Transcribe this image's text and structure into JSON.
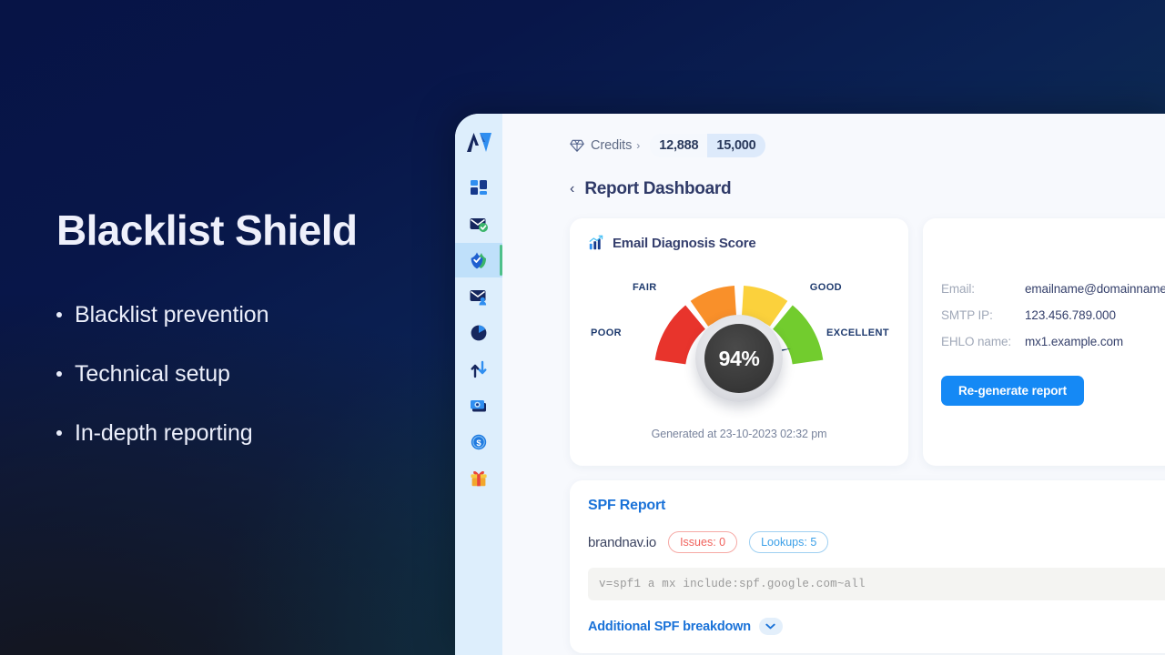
{
  "promo": {
    "title": "Blacklist Shield",
    "bullets": [
      "Blacklist prevention",
      "Technical setup",
      "In-depth reporting"
    ]
  },
  "sidebar": {
    "logo_icon": "av-logo-icon",
    "items": [
      {
        "icon": "dashboard-grid-icon",
        "name": "dashboard"
      },
      {
        "icon": "email-verified-icon",
        "name": "email-verify"
      },
      {
        "icon": "shield-check-icon",
        "name": "blacklist-shield",
        "active": true
      },
      {
        "icon": "email-contact-icon",
        "name": "email-contacts"
      },
      {
        "icon": "pie-chart-icon",
        "name": "analytics"
      },
      {
        "icon": "transfer-arrows-icon",
        "name": "transfers"
      },
      {
        "icon": "money-stack-icon",
        "name": "billing"
      },
      {
        "icon": "dollar-coin-icon",
        "name": "payments"
      },
      {
        "icon": "gift-box-icon",
        "name": "rewards"
      }
    ]
  },
  "credits": {
    "gem_icon": "diamond-icon",
    "label": "Credits",
    "caret": "›",
    "used": "12,888",
    "total": "15,000"
  },
  "header": {
    "back_chevron": "‹",
    "title": "Report Dashboard"
  },
  "score_card": {
    "icon": "bar-chart-up-icon",
    "title": "Email Diagnosis Score",
    "generated_at": "Generated at 23-10-2023 02:32 pm"
  },
  "detail_card": {
    "rows": [
      {
        "key": "Email:",
        "value": "emailname@domainname.com"
      },
      {
        "key": "SMTP IP:",
        "value": "123.456.789.000"
      },
      {
        "key": "EHLO name:",
        "value": "mx1.example.com"
      }
    ],
    "regenerate_label": "Re-generate report"
  },
  "spf_card": {
    "title": "SPF Report",
    "domain": "brandnav.io",
    "issues_label": "Issues: 0",
    "lookups_label": "Lookups: 5",
    "record": "v=spf1 a mx include:spf.google.com~all",
    "more_label": "Additional SPF breakdown",
    "chevron_icon": "chevron-down-icon"
  },
  "colors": {
    "accent_blue": "#1589f5",
    "link_blue": "#1a72d8",
    "poor_red": "#e8342c",
    "fair_orange": "#f9902a",
    "good_yellow": "#fbd13c",
    "excellent_green": "#72cc2e",
    "active_green": "#4ec08a",
    "sidebar_bg": "#ddeefc"
  },
  "chart_data": {
    "type": "gauge",
    "title": "Email Diagnosis Score",
    "value": 94,
    "value_label": "94%",
    "unit": "%",
    "range": [
      0,
      100
    ],
    "axis_start_deg": 180,
    "axis_end_deg": 360,
    "needle_value": 94,
    "segments": [
      {
        "label": "POOR",
        "from": 0,
        "to": 25,
        "color": "#e8342c"
      },
      {
        "label": "FAIR",
        "from": 25,
        "to": 50,
        "color": "#f9902a"
      },
      {
        "label": "GOOD",
        "from": 50,
        "to": 75,
        "color": "#fbd13c"
      },
      {
        "label": "EXCELLENT",
        "from": 75,
        "to": 100,
        "color": "#72cc2e"
      }
    ],
    "legend_position": "around-arc",
    "grid": false,
    "annotation": "Generated at 23-10-2023 02:32 pm"
  }
}
